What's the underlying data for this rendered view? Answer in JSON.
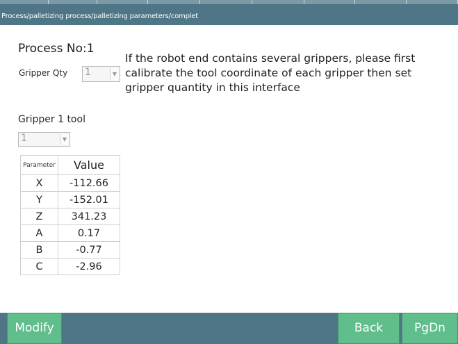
{
  "header": {
    "breadcrumb": "Process/palletizing process/palletizing parameters/complet"
  },
  "process": {
    "label": "Process No:1"
  },
  "gripper_qty": {
    "label": "Gripper Qty",
    "value": "1"
  },
  "hint": "If the robot end contains several grippers, please first calibrate the tool coordinate of each gripper then set gripper quantity in this interface",
  "gripper_tool": {
    "label": "Gripper 1 tool",
    "value": "1"
  },
  "table": {
    "headers": [
      "Parameter",
      "Value"
    ],
    "rows": [
      {
        "param": "X",
        "value": "-112.66"
      },
      {
        "param": "Y",
        "value": "-152.01"
      },
      {
        "param": "Z",
        "value": "341.23"
      },
      {
        "param": "A",
        "value": "0.17"
      },
      {
        "param": "B",
        "value": "-0.77"
      },
      {
        "param": "C",
        "value": "-2.96"
      }
    ]
  },
  "footer": {
    "modify_label": "Modify",
    "back_label": "Back",
    "pgdn_label": "PgDn"
  },
  "colors": {
    "header_bar": "#4f7686",
    "button_green": "#5fbe8b",
    "footer_bar": "#4f7686"
  }
}
